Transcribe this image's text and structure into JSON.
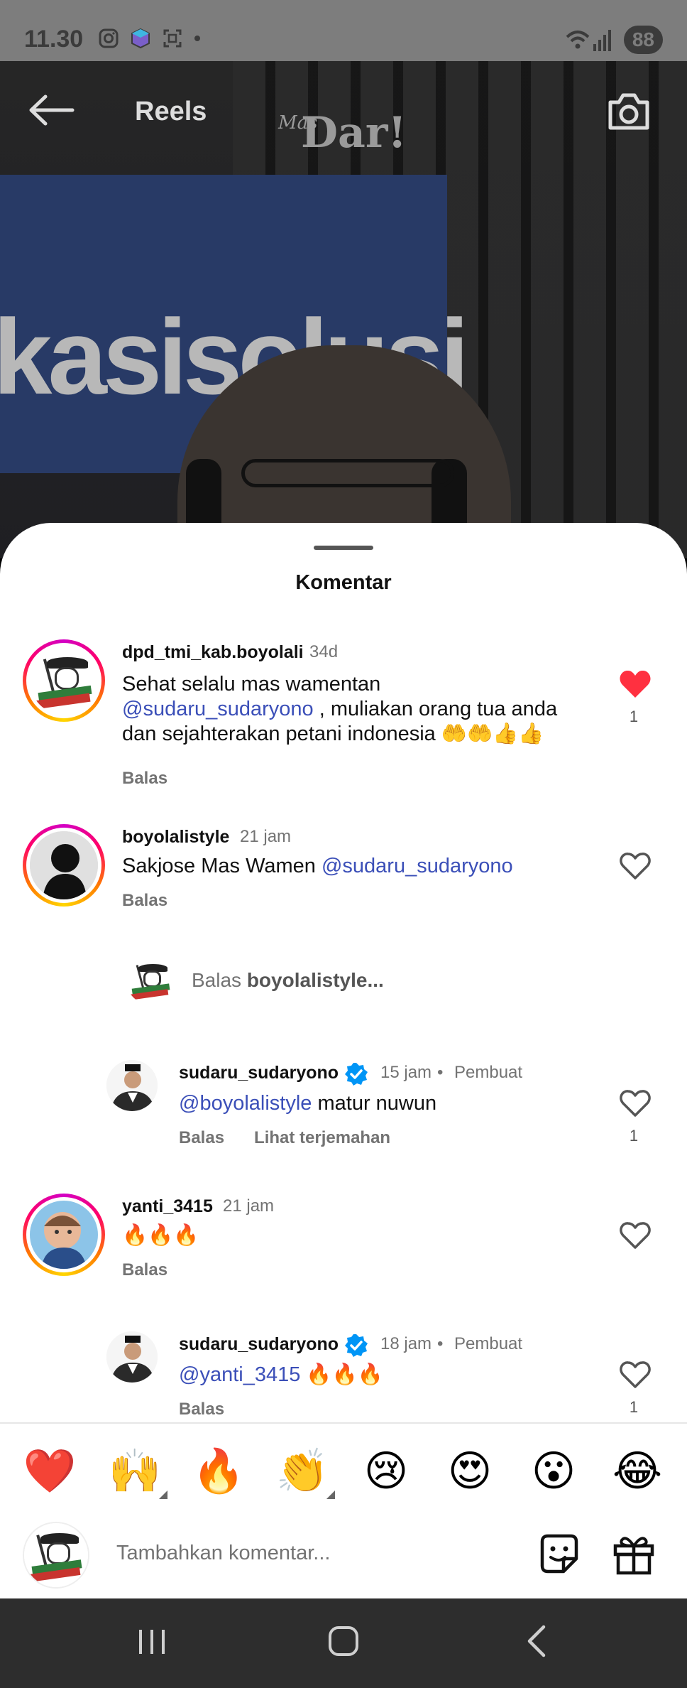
{
  "status_bar": {
    "time": "11.30",
    "battery": "88"
  },
  "header": {
    "title": "Reels",
    "logo_small": "Mas",
    "logo_main": "Dar!"
  },
  "video": {
    "wall_text": "kasisolusi"
  },
  "sheet": {
    "title": "Komentar"
  },
  "comments": [
    {
      "username": "dpd_tmi_kab.boyolali",
      "time": "34d",
      "text_before": "Sehat selalu mas wamentan ",
      "mention": "@sudaru_sudaryono",
      "text_after": " , muliakan orang tua anda dan sejahterakan petani indonesia 🤲🤲👍👍",
      "reply_label": "Balas",
      "like_count": "1",
      "liked": true
    },
    {
      "username": "boyolalistyle",
      "time": "21 jam",
      "text_before": "Sakjose Mas Wamen ",
      "mention": "@sudaru_sudaryono",
      "reply_label": "Balas"
    },
    {
      "username": "sudaru_sudaryono",
      "time": "15 jam",
      "creator_label": "Pembuat",
      "mention": "@boyolalistyle",
      "text_after": " matur nuwun",
      "reply_label": "Balas",
      "translate_label": "Lihat terjemahan",
      "like_count": "1"
    },
    {
      "username": "yanti_3415",
      "time": "21 jam",
      "text": "🔥🔥🔥",
      "reply_label": "Balas"
    },
    {
      "username": "sudaru_sudaryono",
      "time": "18 jam",
      "creator_label": "Pembuat",
      "mention": "@yanti_3415",
      "text_after": " 🔥🔥🔥",
      "reply_label": "Balas",
      "like_count": "1"
    }
  ],
  "reply_prompt": {
    "prefix": "Balas ",
    "user": "boyolalistyle..."
  },
  "emoji_bar": [
    "❤️",
    "🙌",
    "🔥",
    "👏",
    "😢",
    "😍",
    "😮",
    "😂"
  ],
  "composer": {
    "placeholder": "Tambahkan komentar..."
  },
  "colors": {
    "like_red": "#ff3040",
    "mention_blue": "#3b4fb8",
    "verified_blue": "#0095f6"
  }
}
